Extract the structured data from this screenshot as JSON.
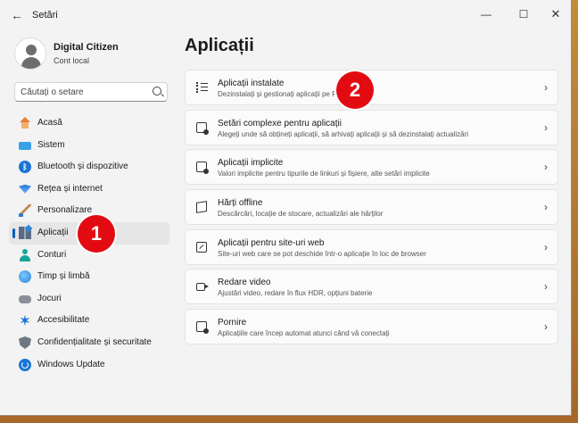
{
  "window": {
    "title": "Setări"
  },
  "profile": {
    "name": "Digital Citizen",
    "account_type": "Cont local"
  },
  "search": {
    "placeholder": "Căutați o setare"
  },
  "sidebar": {
    "items": [
      {
        "label": "Acasă",
        "icon": "home-icon"
      },
      {
        "label": "Sistem",
        "icon": "system-icon"
      },
      {
        "label": "Bluetooth și dispozitive",
        "icon": "bluetooth-icon"
      },
      {
        "label": "Rețea și internet",
        "icon": "wifi-icon"
      },
      {
        "label": "Personalizare",
        "icon": "brush-icon"
      },
      {
        "label": "Aplicații",
        "icon": "apps-icon",
        "selected": true
      },
      {
        "label": "Conturi",
        "icon": "account-icon"
      },
      {
        "label": "Timp și limbă",
        "icon": "globe-clock-icon"
      },
      {
        "label": "Jocuri",
        "icon": "gamepad-icon"
      },
      {
        "label": "Accesibilitate",
        "icon": "accessibility-icon"
      },
      {
        "label": "Confidențialitate și securitate",
        "icon": "shield-icon"
      },
      {
        "label": "Windows Update",
        "icon": "update-icon"
      }
    ]
  },
  "main": {
    "title": "Aplicații",
    "cards": [
      {
        "title": "Aplicații instalate",
        "description": "Dezinstalați și gestionați aplicații pe PC",
        "icon": "list-icon"
      },
      {
        "title": "Setări complexe pentru aplicații",
        "description": "Alegeți unde să obțineți aplicații, să arhivați aplicații și să dezinstalați actualizări",
        "icon": "advanced-settings-icon"
      },
      {
        "title": "Aplicații implicite",
        "description": "Valori implicite pentru tipurile de linkuri și fișiere, alte setări implicite",
        "icon": "default-apps-icon"
      },
      {
        "title": "Hărți offline",
        "description": "Descărcări, locație de stocare, actualizări ale hărților",
        "icon": "map-icon"
      },
      {
        "title": "Aplicații pentru site-uri web",
        "description": "Site-uri web care se pot deschide într-o aplicație în loc de browser",
        "icon": "web-app-icon"
      },
      {
        "title": "Redare video",
        "description": "Ajustări video, redare în flux HDR, opțiuni baterie",
        "icon": "video-icon"
      },
      {
        "title": "Pornire",
        "description": "Aplicațiile care încep automat atunci când vă conectați",
        "icon": "startup-icon"
      }
    ]
  },
  "annotations": {
    "badge1": "1",
    "badge2": "2"
  },
  "colors": {
    "accent": "#005fb8",
    "badge": "#e30b12"
  }
}
